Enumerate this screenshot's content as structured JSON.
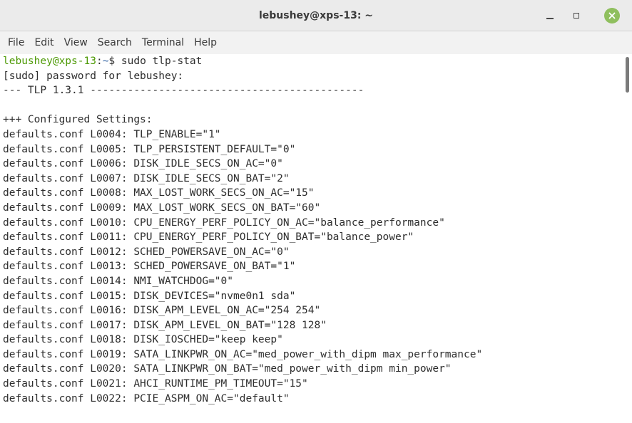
{
  "window": {
    "title": "lebushey@xps-13: ~"
  },
  "menu": [
    "File",
    "Edit",
    "View",
    "Search",
    "Terminal",
    "Help"
  ],
  "prompt": {
    "user_host": "lebushey@xps-13",
    "sep": ":",
    "path": "~",
    "symbol": "$ ",
    "command": "sudo tlp-stat"
  },
  "output_lines": [
    "[sudo] password for lebushey:",
    "--- TLP 1.3.1 --------------------------------------------",
    "",
    "+++ Configured Settings:",
    "defaults.conf L0004: TLP_ENABLE=\"1\"",
    "defaults.conf L0005: TLP_PERSISTENT_DEFAULT=\"0\"",
    "defaults.conf L0006: DISK_IDLE_SECS_ON_AC=\"0\"",
    "defaults.conf L0007: DISK_IDLE_SECS_ON_BAT=\"2\"",
    "defaults.conf L0008: MAX_LOST_WORK_SECS_ON_AC=\"15\"",
    "defaults.conf L0009: MAX_LOST_WORK_SECS_ON_BAT=\"60\"",
    "defaults.conf L0010: CPU_ENERGY_PERF_POLICY_ON_AC=\"balance_performance\"",
    "defaults.conf L0011: CPU_ENERGY_PERF_POLICY_ON_BAT=\"balance_power\"",
    "defaults.conf L0012: SCHED_POWERSAVE_ON_AC=\"0\"",
    "defaults.conf L0013: SCHED_POWERSAVE_ON_BAT=\"1\"",
    "defaults.conf L0014: NMI_WATCHDOG=\"0\"",
    "defaults.conf L0015: DISK_DEVICES=\"nvme0n1 sda\"",
    "defaults.conf L0016: DISK_APM_LEVEL_ON_AC=\"254 254\"",
    "defaults.conf L0017: DISK_APM_LEVEL_ON_BAT=\"128 128\"",
    "defaults.conf L0018: DISK_IOSCHED=\"keep keep\"",
    "defaults.conf L0019: SATA_LINKPWR_ON_AC=\"med_power_with_dipm max_performance\"",
    "defaults.conf L0020: SATA_LINKPWR_ON_BAT=\"med_power_with_dipm min_power\"",
    "defaults.conf L0021: AHCI_RUNTIME_PM_TIMEOUT=\"15\"",
    "defaults.conf L0022: PCIE_ASPM_ON_AC=\"default\""
  ],
  "colors": {
    "prompt_user": "#4e9a06",
    "prompt_path": "#3465a4",
    "close_button": "#8fbf5e"
  },
  "icons": {
    "minimize": "minimize-icon",
    "maximize": "maximize-icon",
    "close": "close-icon"
  }
}
